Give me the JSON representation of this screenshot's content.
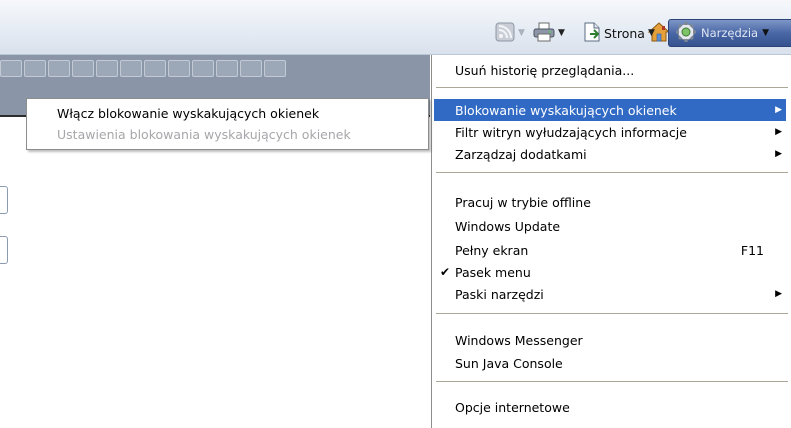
{
  "toolbar": {
    "page_label": "Strona",
    "tools_label": "Narzędzia",
    "icons": [
      "home-icon",
      "feeds-icon",
      "print-icon",
      "page-icon",
      "gear-icon"
    ]
  },
  "tools_menu": {
    "items": [
      {
        "label": "Usuń historię przeglądania..."
      },
      {
        "label": "Blokowanie wyskakujących okienek",
        "submenu": true,
        "highlighted": true
      },
      {
        "label": "Filtr witryn wyłudzających informacje",
        "submenu": true
      },
      {
        "label": "Zarządzaj dodatkami",
        "submenu": true
      },
      {
        "label": "Pracuj w trybie offline"
      },
      {
        "label": "Windows Update"
      },
      {
        "label": "Pełny ekran",
        "shortcut": "F11"
      },
      {
        "label": "Pasek menu",
        "checked": true
      },
      {
        "label": "Paski narzędzi",
        "submenu": true
      },
      {
        "label": "Windows Messenger"
      },
      {
        "label": "Sun Java Console"
      },
      {
        "label": "Opcje internetowe"
      }
    ]
  },
  "popup_submenu": {
    "items": [
      {
        "label": "Włącz blokowanie wyskakujących okienek",
        "enabled": true
      },
      {
        "label": "Ustawienia blokowania wyskakujących okienek",
        "enabled": false
      }
    ]
  },
  "colors": {
    "highlight": "#316ac5",
    "disabled_text": "#a7a6aa",
    "tools_button": "#4a67a6"
  }
}
